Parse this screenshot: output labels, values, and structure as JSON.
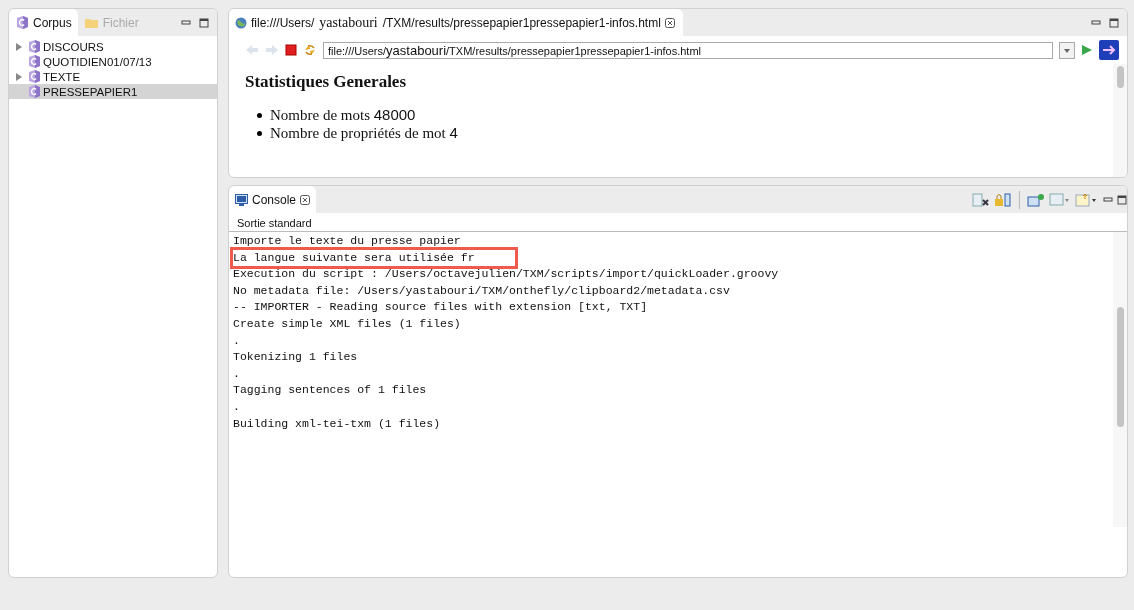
{
  "corpus_panel": {
    "tabs": [
      {
        "label": "Corpus",
        "selected": true
      },
      {
        "label": "Fichier",
        "selected": false
      }
    ],
    "tree": [
      {
        "label": "DISCOURS",
        "expandable": true,
        "expanded": false,
        "selected": false
      },
      {
        "label": "QUOTIDIEN01/07/13",
        "expandable": false,
        "expanded": false,
        "selected": false
      },
      {
        "label": "TEXTE",
        "expandable": true,
        "expanded": false,
        "selected": false
      },
      {
        "label": "PRESSEPAPIER1",
        "expandable": false,
        "expanded": false,
        "selected": true
      }
    ]
  },
  "browser": {
    "tab": {
      "title_parts": [
        "file:///Users/",
        "yastabouri",
        "/TXM/results/pressepapier1pressepapier1-infos.html"
      ]
    },
    "url_parts": [
      "file:///Users/",
      "yastabouri",
      "/TXM/results/pressepapier1pressepapier1-infos.html"
    ],
    "heading": "Statistiques Generales",
    "items": [
      {
        "label": "Nombre de mots",
        "value": "48000"
      },
      {
        "label": "Nombre de propriétés de mot",
        "value": "4"
      }
    ]
  },
  "console": {
    "tab": "Console",
    "section": "Sortie standard",
    "lines": [
      {
        "text": "Importe le texte du presse papier",
        "highlighted": false
      },
      {
        "text": "La langue suivante sera utilisée fr",
        "highlighted": true
      },
      {
        "text": "Execution du script : /Users/octavejulien/TXM/scripts/import/quickLoader.groovy",
        "highlighted": false
      },
      {
        "text": "No metadata file: /Users/yastabouri/TXM/onthefly/clipboard2/metadata.csv",
        "highlighted": false
      },
      {
        "text": "-- IMPORTER - Reading source files with extension [txt, TXT]",
        "highlighted": false
      },
      {
        "text": "Create simple XML files (1 files)",
        "highlighted": false
      },
      {
        "text": ".",
        "highlighted": false
      },
      {
        "text": "Tokenizing 1 files",
        "highlighted": false
      },
      {
        "text": ".",
        "highlighted": false
      },
      {
        "text": "Tagging sentences of 1 files",
        "highlighted": false
      },
      {
        "text": ".",
        "highlighted": false
      },
      {
        "text": "Building xml-tei-txm (1 files)",
        "highlighted": false
      }
    ]
  }
}
